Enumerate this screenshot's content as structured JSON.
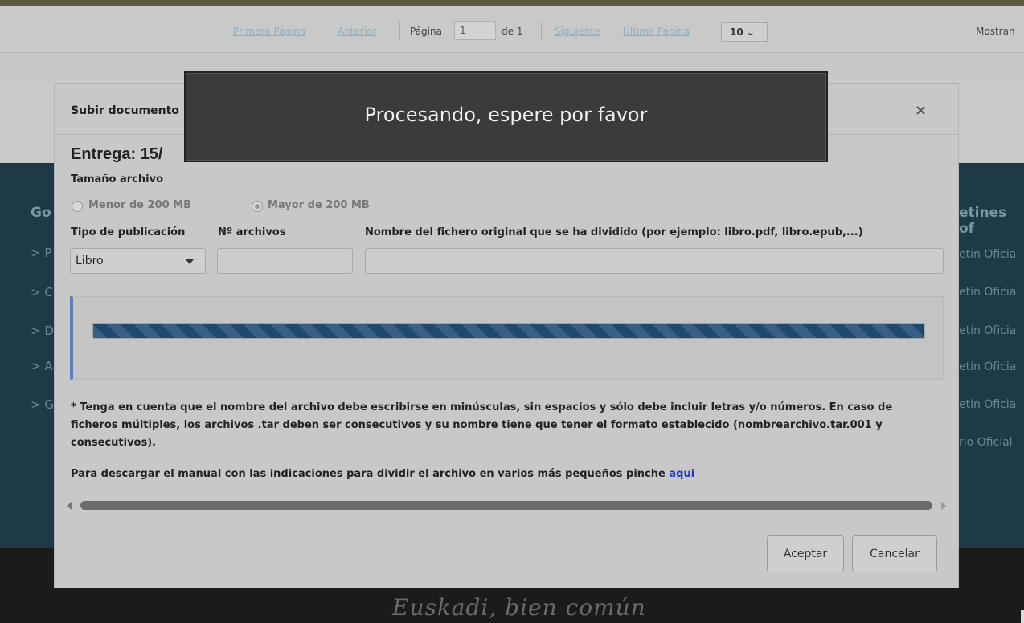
{
  "pager": {
    "first": "Primera Página",
    "prev": "Anterior",
    "page_label": "Página",
    "page_value": "1",
    "of": "de 1",
    "next": "Siguiente",
    "last": "Última Página",
    "per_page": "10",
    "showing": "Mostran"
  },
  "background": {
    "left_heading": "Go",
    "left_items": [
      "> P",
      "> C",
      "> D",
      "> A",
      "> G"
    ],
    "right_heading": "etines of",
    "right_items": [
      "etín Oficia",
      "etín Oficia",
      "etín Oficia",
      "etín Oficia",
      "etín Oficia",
      "rio Oficial"
    ],
    "slogan": "Euskadi, bien común"
  },
  "modal": {
    "title": "Subir documento",
    "close": "×",
    "entrega": "Entrega: 15/",
    "size_label": "Tamaño archivo",
    "size_options": [
      "Menor de 200 MB",
      "Mayor de 200 MB"
    ],
    "selected_size": "Mayor de 200 MB",
    "type_label": "Tipo de publicación",
    "type_value": "Libro",
    "count_label": "Nº archivos",
    "count_value": "",
    "filename_label": "Nombre del fichero original que se ha dividido (por ejemplo: libro.pdf, libro.epub,...)",
    "filename_value": "",
    "progress": 1.0,
    "note": "* Tenga en cuenta que el nombre del archivo debe escribirse en minúsculas, sin espacios y sólo debe incluir letras y/o números. En caso de ficheros múltiples, los archivos .tar deben ser consecutivos y su nombre tiene que tener el formato establecido (nombrearchivo.tar.001 y consecutivos).",
    "manual_text": "Para descargar el manual con las indicaciones para dividir el archivo en varios más pequeños pinche",
    "manual_link": "aqui",
    "accept": "Aceptar",
    "cancel": "Cancelar"
  },
  "overlay": {
    "message": "Procesando, espere por favor"
  },
  "colors": {
    "progress": "#1e4a72",
    "accent_border": "#5b80b8",
    "link": "#1d39c4"
  }
}
